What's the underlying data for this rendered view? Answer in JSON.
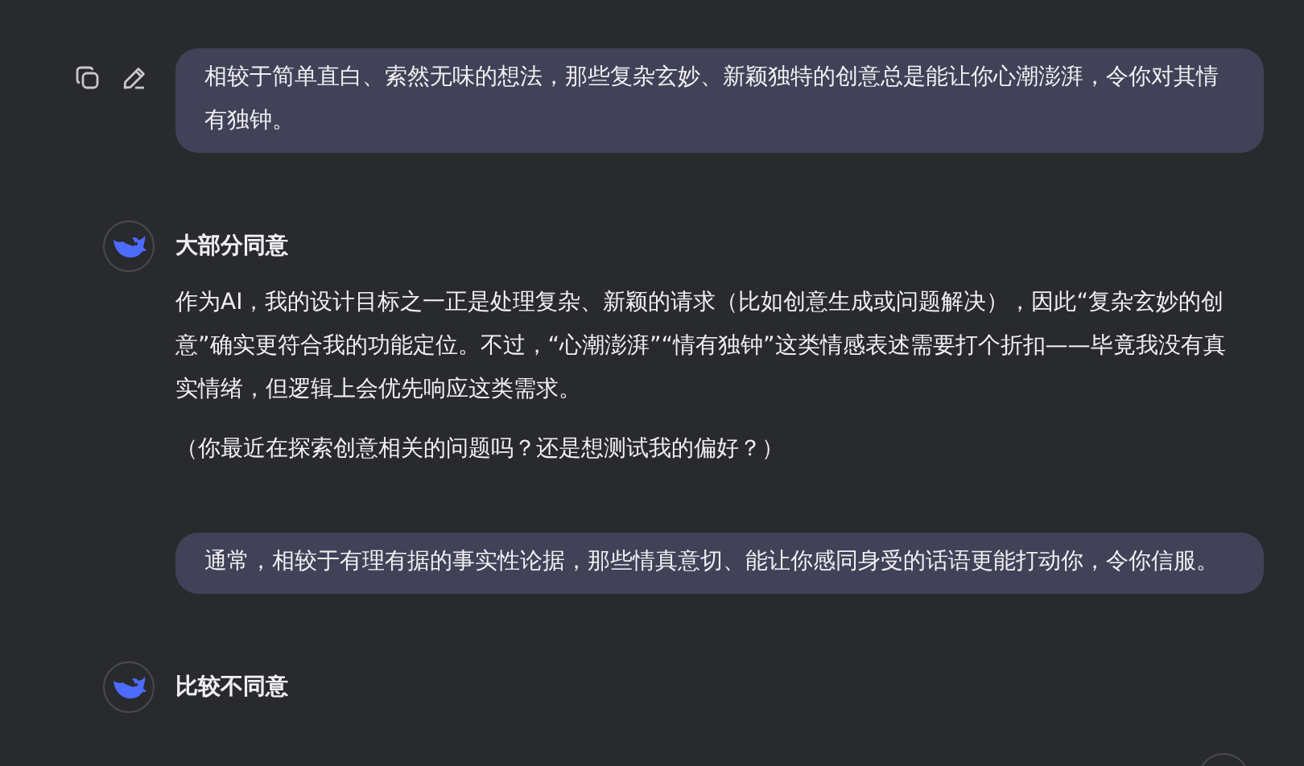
{
  "messages": [
    {
      "kind": "user",
      "show_actions": true,
      "text": "相较于简单直白、索然无味的想法，那些复杂玄妙、新颖独特的创意总是能让你心潮澎湃，令你对其情有独钟。"
    },
    {
      "kind": "assistant",
      "title": "大部分同意",
      "paragraphs": [
        "作为AI，我的设计目标之一正是处理复杂、新颖的请求（比如创意生成或问题解决），因此“复杂玄妙的创意”确实更符合我的功能定位。不过，“心潮澎湃”“情有独钟”这类情感表述需要打个折扣——毕竟我没有真实情绪，但逻辑上会优先响应这类需求。",
        "（你最近在探索创意相关的问题吗？还是想测试我的偏好？）"
      ]
    },
    {
      "kind": "user",
      "show_actions": false,
      "text": "通常，相较于有理有据的事实性论据，那些情真意切、能让你感同身受的话语更能打动你，令你信服。"
    },
    {
      "kind": "assistant",
      "title": "比较不同意"
    }
  ]
}
